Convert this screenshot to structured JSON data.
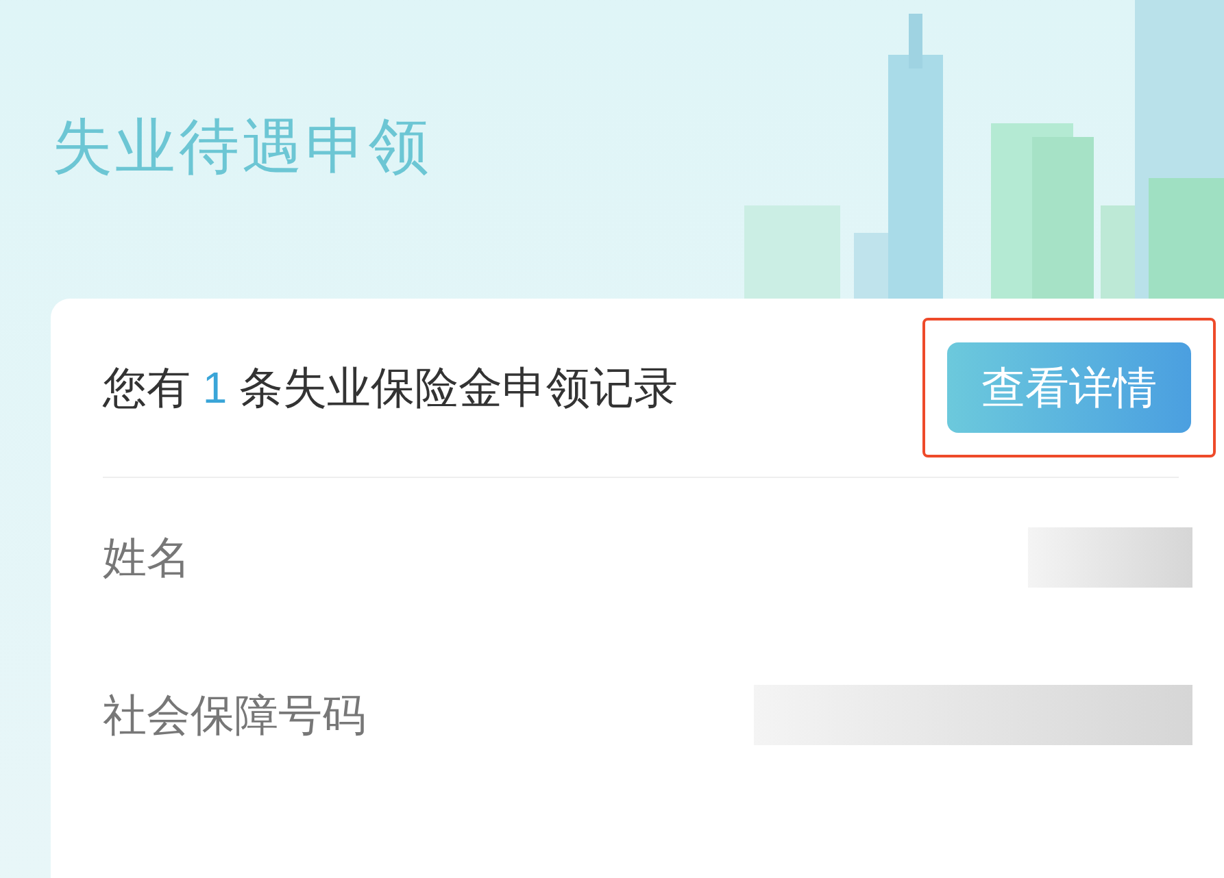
{
  "page_title": "失业待遇申领",
  "record_summary": {
    "prefix": "您有",
    "count": "1",
    "suffix": "条失业保险金申领记录"
  },
  "details_button": {
    "label": "查看详情",
    "highlighted": true
  },
  "fields": [
    {
      "label": "姓名"
    },
    {
      "label": "社会保障号码"
    }
  ]
}
